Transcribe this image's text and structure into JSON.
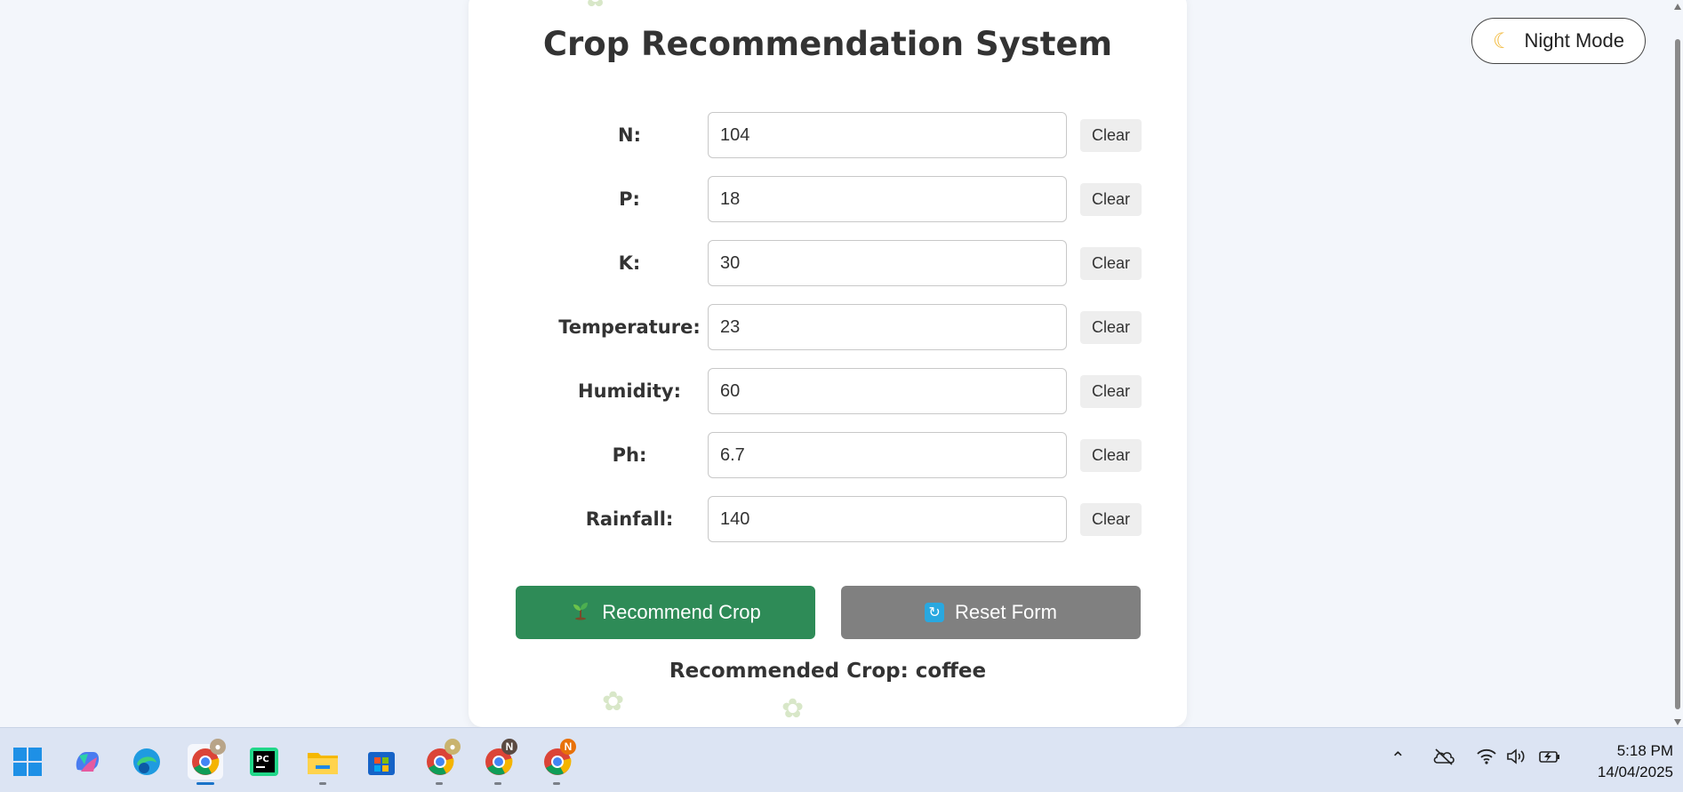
{
  "header": {
    "night_mode_label": "Night Mode",
    "night_mode_icon": "moon-icon"
  },
  "form": {
    "title": "Crop Recommendation System",
    "fields": [
      {
        "label": "N:",
        "value": "104",
        "clear_label": "Clear"
      },
      {
        "label": "P:",
        "value": "18",
        "clear_label": "Clear"
      },
      {
        "label": "K:",
        "value": "30",
        "clear_label": "Clear"
      },
      {
        "label": "Temperature:",
        "value": "23",
        "clear_label": "Clear"
      },
      {
        "label": "Humidity:",
        "value": "60",
        "clear_label": "Clear"
      },
      {
        "label": "Ph:",
        "value": "6.7",
        "clear_label": "Clear"
      },
      {
        "label": "Rainfall:",
        "value": "140",
        "clear_label": "Clear"
      }
    ],
    "recommend_label": "Recommend Crop",
    "reset_label": "Reset Form",
    "result_text": "Recommended Crop: coffee"
  },
  "colors": {
    "recommend_button": "#2e8b57",
    "reset_button": "#808080",
    "background": "#f3f6fb"
  },
  "taskbar": {
    "apps": [
      "windows-start",
      "copilot",
      "edge",
      "chrome",
      "pycharm",
      "file-explorer",
      "microsoft-store",
      "chrome",
      "chrome",
      "chrome"
    ],
    "badges": {
      "chrome_2": "N",
      "chrome_3": "N"
    },
    "time": "5:18 PM",
    "date": "14/04/2025"
  }
}
